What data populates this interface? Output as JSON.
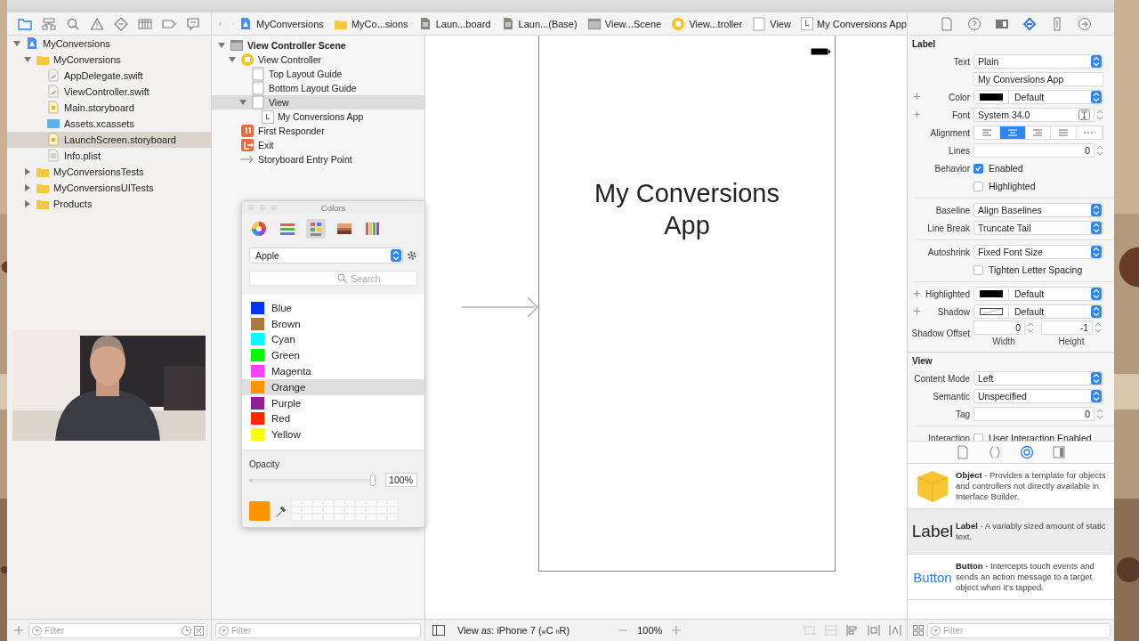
{
  "navigator_tabs": [
    {
      "selected": true
    },
    {
      "selected": false
    },
    {
      "selected": false
    },
    {
      "selected": false
    },
    {
      "selected": false
    },
    {
      "selected": false
    },
    {
      "selected": false
    },
    {
      "selected": false
    }
  ],
  "jump_bar": [
    {
      "kind": "project",
      "label": "MyConversions"
    },
    {
      "kind": "folder",
      "label": "MyCo...sions"
    },
    {
      "kind": "file",
      "label": "Laun...board"
    },
    {
      "kind": "file",
      "label": "Laun...(Base)"
    },
    {
      "kind": "scene",
      "label": "View...Scene"
    },
    {
      "kind": "controller",
      "label": "View...troller"
    },
    {
      "kind": "view",
      "label": "View"
    },
    {
      "kind": "label",
      "badge": "L",
      "label": "My Conversions App"
    }
  ],
  "inspector_tabs": [
    {
      "selected": false
    },
    {
      "selected": false
    },
    {
      "selected": false
    },
    {
      "selected": true
    },
    {
      "selected": false
    },
    {
      "selected": false
    }
  ],
  "navigator": {
    "tree": [
      {
        "kind": "project",
        "label": "MyConversions",
        "expanded": true,
        "selected": false,
        "children": [
          {
            "kind": "folder",
            "label": "MyConversions",
            "expanded": true,
            "selected": false,
            "children": [
              {
                "kind": "swift",
                "label": "AppDelegate.swift",
                "selected": false
              },
              {
                "kind": "swift",
                "label": "ViewController.swift",
                "selected": false
              },
              {
                "kind": "storyboard",
                "label": "Main.storyboard",
                "selected": false
              },
              {
                "kind": "assets",
                "label": "Assets.xcassets",
                "selected": false
              },
              {
                "kind": "storyboard",
                "label": "LaunchScreen.storyboard",
                "selected": true
              },
              {
                "kind": "plist",
                "label": "Info.plist",
                "selected": false
              }
            ]
          },
          {
            "kind": "folder",
            "label": "MyConversionsTests",
            "expanded": false,
            "selected": false
          },
          {
            "kind": "folder",
            "label": "MyConversionsUITests",
            "expanded": false,
            "selected": false
          },
          {
            "kind": "folder",
            "label": "Products",
            "expanded": false,
            "selected": false
          }
        ]
      }
    ],
    "filter": {
      "placeholder": "Filter"
    }
  },
  "outline": {
    "tree": [
      {
        "kind": "scene",
        "label": "View Controller Scene",
        "expanded": true,
        "selected": false,
        "children": [
          {
            "kind": "controller",
            "label": "View Controller",
            "expanded": true,
            "selected": false,
            "children": [
              {
                "kind": "guide",
                "label": "Top Layout Guide",
                "selected": false
              },
              {
                "kind": "guide",
                "label": "Bottom Layout Guide",
                "selected": false
              },
              {
                "kind": "view",
                "label": "View",
                "expanded": true,
                "selected": true,
                "children": [
                  {
                    "kind": "label",
                    "badge": "L",
                    "label": "My Conversions App",
                    "selected": false
                  }
                ]
              }
            ]
          },
          {
            "kind": "responder",
            "label": "First Responder",
            "selected": false
          },
          {
            "kind": "exit",
            "label": "Exit",
            "selected": false
          },
          {
            "kind": "entry",
            "label": "Storyboard Entry Point",
            "selected": false
          }
        ]
      }
    ],
    "filter": {
      "placeholder": "Filter"
    }
  },
  "canvas": {
    "label_text": "My Conversions App"
  },
  "colors_panel": {
    "title": "Colors",
    "modes": [
      {
        "selected": false
      },
      {
        "selected": false
      },
      {
        "selected": true
      },
      {
        "selected": false
      },
      {
        "selected": false
      }
    ],
    "palette": "Apple",
    "search": {
      "placeholder": "Search"
    },
    "colors": [
      {
        "name": "Blue",
        "color": "#0433ff",
        "selected": false
      },
      {
        "name": "Brown",
        "color": "#aa7942",
        "selected": false
      },
      {
        "name": "Cyan",
        "color": "#00fdff",
        "selected": false
      },
      {
        "name": "Green",
        "color": "#00f900",
        "selected": false
      },
      {
        "name": "Magenta",
        "color": "#ff40ff",
        "selected": false
      },
      {
        "name": "Orange",
        "color": "#ff9300",
        "selected": true
      },
      {
        "name": "Purple",
        "color": "#942192",
        "selected": false
      },
      {
        "name": "Red",
        "color": "#ff2600",
        "selected": false
      },
      {
        "name": "Yellow",
        "color": "#fffb00",
        "selected": false
      }
    ],
    "opacity": {
      "label": "Opacity",
      "level": 1.0,
      "reading": "100%"
    }
  },
  "inspector": {
    "sections": [
      {
        "title": "Label",
        "rows": [
          {
            "kind": "popup",
            "label": "Text",
            "value": "Plain"
          },
          {
            "kind": "field",
            "value": "My Conversions App"
          },
          {
            "kind": "color_popup",
            "plus": true,
            "label": "Color",
            "swatch_clear": false,
            "value": "Default"
          },
          {
            "kind": "font",
            "plus": true,
            "label": "Font",
            "value": "System 34.0"
          },
          {
            "kind": "alignment",
            "label": "Alignment",
            "options": [
              {
                "selected": false
              },
              {
                "selected": true
              },
              {
                "selected": false
              },
              {
                "selected": false
              },
              {
                "selected": false
              }
            ]
          },
          {
            "kind": "stepper",
            "label": "Lines",
            "value": "0"
          },
          {
            "kind": "check",
            "label": "Behavior",
            "text": "Enabled",
            "checked": true
          },
          {
            "kind": "check",
            "text": "Highlighted",
            "checked": false
          },
          {
            "kind": "divider"
          },
          {
            "kind": "popup",
            "label": "Baseline",
            "value": "Align Baselines"
          },
          {
            "kind": "popup",
            "label": "Line Break",
            "value": "Truncate Tail"
          },
          {
            "kind": "divider"
          },
          {
            "kind": "popup",
            "label": "Autoshrink",
            "value": "Fixed Font Size"
          },
          {
            "kind": "check",
            "text": "Tighten Letter Spacing",
            "checked": false
          },
          {
            "kind": "divider"
          },
          {
            "kind": "color_popup",
            "plus": true,
            "label": "Highlighted",
            "swatch_clear": false,
            "value": "Default"
          },
          {
            "kind": "color_popup",
            "plus": true,
            "label": "Shadow",
            "swatch_clear": true,
            "value": "Default"
          },
          {
            "kind": "pair",
            "label": "Shadow Offset",
            "fields": [
              {
                "value": "0",
                "caption": "Width"
              },
              {
                "value": "-1",
                "caption": "Height"
              }
            ]
          }
        ]
      },
      {
        "title": "View",
        "rows": [
          {
            "kind": "popup",
            "label": "Content Mode",
            "value": "Left"
          },
          {
            "kind": "popup",
            "label": "Semantic",
            "value": "Unspecified"
          },
          {
            "kind": "stepper",
            "label": "Tag",
            "value": "0"
          },
          {
            "kind": "divider"
          },
          {
            "kind": "check",
            "label": "Interaction",
            "text": "User Interaction Enabled",
            "checked": false
          }
        ]
      }
    ]
  },
  "library": {
    "tabs": [
      {
        "selected": false
      },
      {
        "selected": false
      },
      {
        "selected": true
      },
      {
        "selected": false
      }
    ],
    "items": [
      {
        "kind": "object",
        "text": "**Object** - Provides a template for objects and controllers not directly available in Interface Builder.",
        "selected": false
      },
      {
        "kind": "label",
        "preview": "Label",
        "text": "**Label** - A variably sized amount of static text.",
        "selected": true
      },
      {
        "kind": "button",
        "preview": "Button",
        "text": "**Button** - Intercepts touch events and sends an action message to a target object when it's tapped.",
        "selected": false
      }
    ],
    "filter": {
      "placeholder": "Filter"
    }
  },
  "canvas_bar": {
    "view_as": "View as: iPhone 7 ($_{w}$C $_{h}$R)",
    "zoom": "100%"
  }
}
